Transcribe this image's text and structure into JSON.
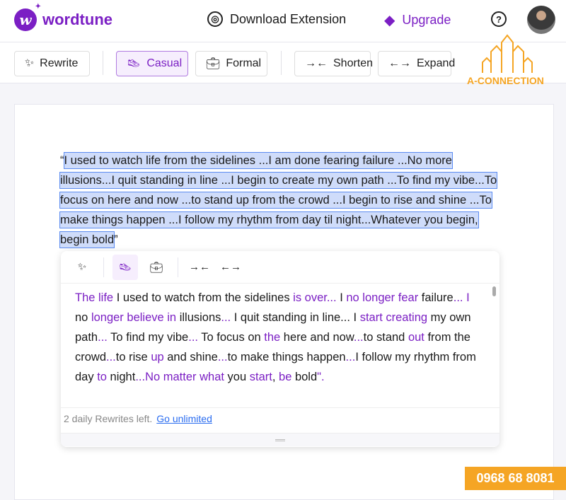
{
  "header": {
    "logo": "wordtune",
    "download": "Download Extension",
    "upgrade": "Upgrade",
    "help_icon": "question-circle-icon",
    "accent": "#7b1fc4"
  },
  "toolbar": {
    "rewrite": "Rewrite",
    "casual": "Casual",
    "formal": "Formal",
    "shorten": "Shorten",
    "expand": "Expand",
    "active": "Casual"
  },
  "editor": {
    "open_quote": "“",
    "selected_text": "I used to watch life from the sidelines ...I am done fearing failure ...No more illusions...I quit standing in line ...I begin to create my own path ...To find my vibe...To focus on here and now ...to stand up from the crowd ...I begin to rise and shine ...To make things happen ...I follow my rhythm from day til night...Whatever you begin, begin bold",
    "close_quote": "”"
  },
  "suggestion": {
    "segments": [
      {
        "t": "The life",
        "c": 1
      },
      {
        "t": " I used to watch from the sidelines ",
        "c": 0
      },
      {
        "t": "is over...",
        "c": 1
      },
      {
        "t": " I ",
        "c": 0
      },
      {
        "t": "no longer fear",
        "c": 1
      },
      {
        "t": " failure",
        "c": 0
      },
      {
        "t": "...",
        "c": 1
      },
      {
        "t": " ",
        "c": 0
      },
      {
        "t": "I",
        "c": 1
      },
      {
        "t": " no ",
        "c": 0
      },
      {
        "t": "longer believe in",
        "c": 1
      },
      {
        "t": " illusions",
        "c": 0
      },
      {
        "t": "...",
        "c": 1
      },
      {
        "t": " I quit standing in line... I ",
        "c": 0
      },
      {
        "t": "start creating",
        "c": 1
      },
      {
        "t": " my own path",
        "c": 0
      },
      {
        "t": "...",
        "c": 1
      },
      {
        "t": " To find my vibe",
        "c": 0
      },
      {
        "t": "...",
        "c": 1
      },
      {
        "t": " To focus on ",
        "c": 0
      },
      {
        "t": "the",
        "c": 1
      },
      {
        "t": " here and now",
        "c": 0
      },
      {
        "t": "...",
        "c": 1
      },
      {
        "t": "to stand ",
        "c": 0
      },
      {
        "t": "out",
        "c": 1
      },
      {
        "t": " from the crowd",
        "c": 0
      },
      {
        "t": "...",
        "c": 1
      },
      {
        "t": "to rise ",
        "c": 0
      },
      {
        "t": "up",
        "c": 1
      },
      {
        "t": " and shine",
        "c": 0
      },
      {
        "t": "...",
        "c": 1
      },
      {
        "t": "to make things happen",
        "c": 0
      },
      {
        "t": "...",
        "c": 1
      },
      {
        "t": "I follow my rhythm from day ",
        "c": 0
      },
      {
        "t": "to",
        "c": 1
      },
      {
        "t": " night",
        "c": 0
      },
      {
        "t": "...No matter what",
        "c": 1
      },
      {
        "t": " you ",
        "c": 0
      },
      {
        "t": "start",
        "c": 1
      },
      {
        "t": ", ",
        "c": 0
      },
      {
        "t": "be",
        "c": 1
      },
      {
        "t": " bold",
        "c": 0
      },
      {
        "t": "\".",
        "c": 1
      }
    ],
    "footer": "2 daily Rewrites left.",
    "link": "Go unlimited"
  },
  "watermark": {
    "brand": "A-CONNECTION",
    "phone": "0968 68 8081"
  }
}
